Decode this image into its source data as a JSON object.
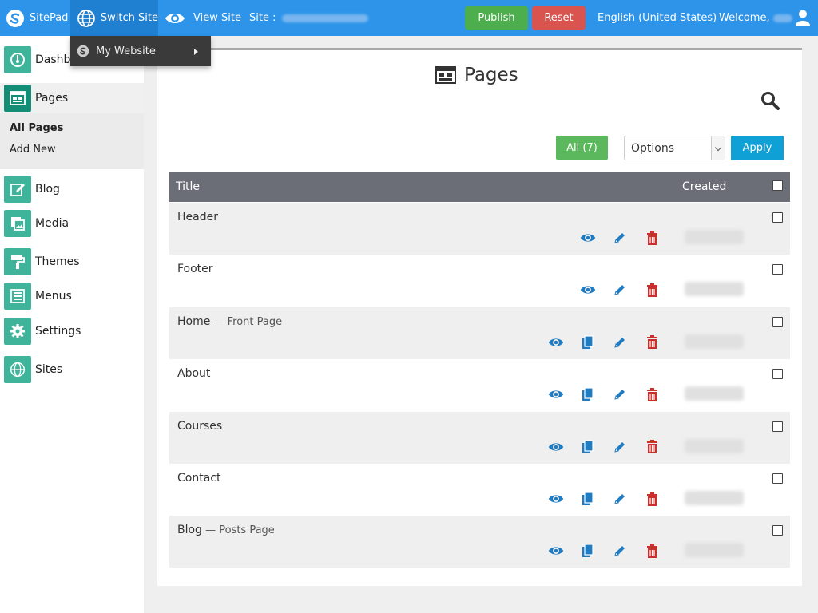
{
  "topbar": {
    "brand": "SitePad",
    "switch_site": "Switch Site",
    "view_site": "View Site",
    "site_label": "Site :",
    "publish": "Publish",
    "reset": "Reset",
    "language": "English (United States)",
    "welcome": "Welcome,"
  },
  "dropdown": {
    "item": "My Website"
  },
  "sidebar": {
    "items": [
      {
        "label": "Dashboard",
        "icon": "dashboard-icon"
      },
      {
        "label": "Pages",
        "icon": "pages-icon"
      },
      {
        "label": "Blog",
        "icon": "blog-icon"
      },
      {
        "label": "Media",
        "icon": "media-icon"
      },
      {
        "label": "Themes",
        "icon": "themes-icon"
      },
      {
        "label": "Menus",
        "icon": "menus-icon"
      },
      {
        "label": "Settings",
        "icon": "settings-icon"
      },
      {
        "label": "Sites",
        "icon": "sites-icon"
      }
    ],
    "submenu": {
      "all_pages": "All Pages",
      "add_new": "Add New"
    }
  },
  "main": {
    "title": "Pages",
    "filter_all": "All (7)",
    "options_select": "Options",
    "apply": "Apply",
    "columns": {
      "title": "Title",
      "created": "Created"
    },
    "rows": [
      {
        "title": "Header",
        "subtitle": "",
        "has_copy": false
      },
      {
        "title": "Footer",
        "subtitle": "",
        "has_copy": false
      },
      {
        "title": "Home",
        "subtitle": " — Front Page",
        "has_copy": true
      },
      {
        "title": "About",
        "subtitle": "",
        "has_copy": true
      },
      {
        "title": "Courses",
        "subtitle": "",
        "has_copy": true
      },
      {
        "title": "Contact",
        "subtitle": "",
        "has_copy": true
      },
      {
        "title": "Blog",
        "subtitle": " — Posts Page",
        "has_copy": true
      }
    ]
  },
  "colors": {
    "topbar": "#2d94e9",
    "publish": "#4cae4c",
    "reset": "#d9534f",
    "sidebar_icon": "#3fb49a",
    "apply": "#0fa0d6",
    "table_header": "#6b6e77",
    "delete_icon": "#c9302c",
    "action_icon": "#1f7cc2"
  }
}
